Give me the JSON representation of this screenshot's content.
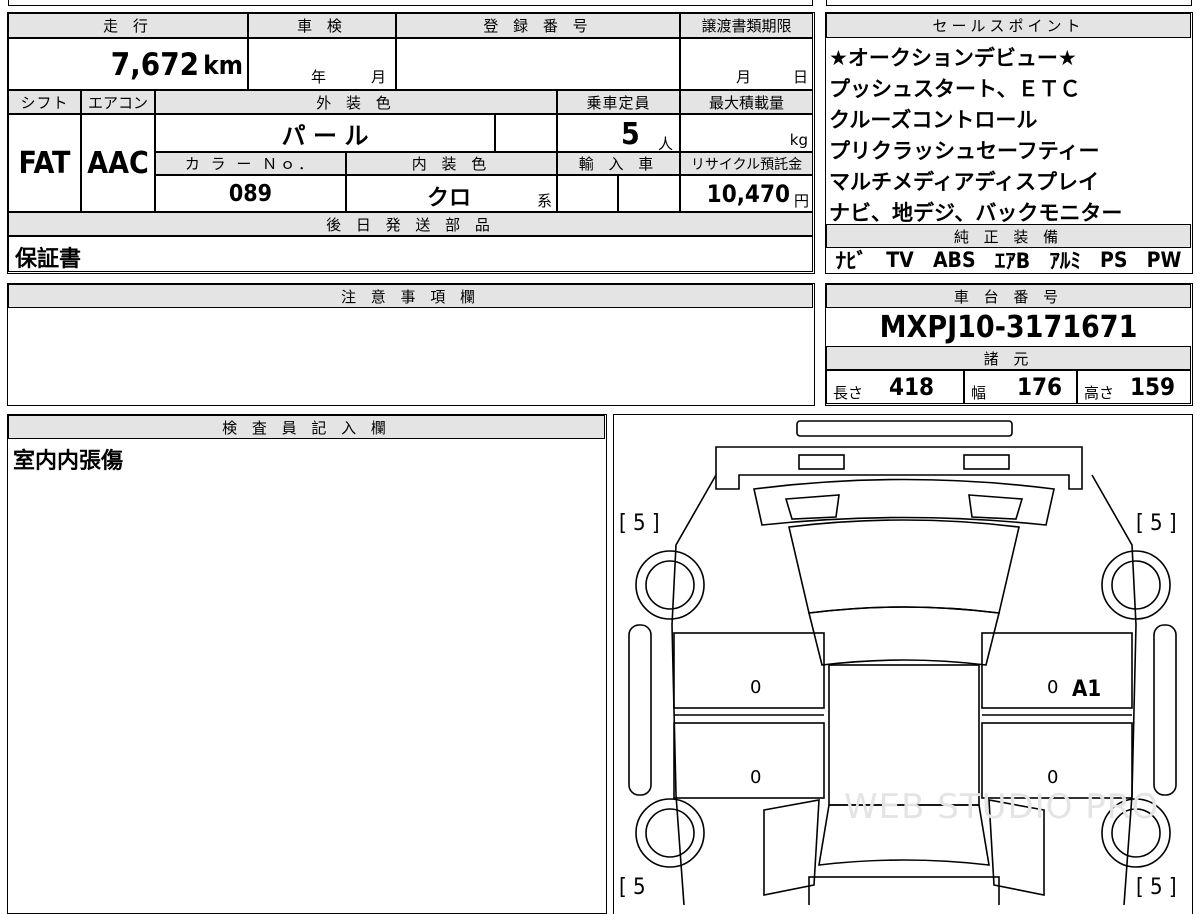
{
  "vehicle": {
    "mileage_label": "走 行",
    "mileage": "7,672",
    "mileage_unit": "km",
    "inspection_label": "車 検",
    "inspection_year": "年",
    "inspection_month": "月",
    "registration_label": "登 録 番 号",
    "transfer_label": "譲渡書類期限",
    "transfer_month": "月",
    "transfer_day": "日",
    "shift_label": "シフト",
    "shift": "FAT",
    "ac_label": "エアコン",
    "ac": "AAC",
    "exterior_label": "外 装 色",
    "exterior": "パ ー ル",
    "capacity_label": "乗車定員",
    "capacity": "5",
    "capacity_unit": "人",
    "maxload_label": "最大積載量",
    "maxload_unit": "kg",
    "color_no_label": "カ ラ ー Ｎｏ．",
    "color_no": "089",
    "interior_label": "内 装 色",
    "interior": "クロ",
    "interior_suffix": "系",
    "import_label": "輸 入 車",
    "recycle_label": "リサイクル預託金",
    "recycle": "10,470",
    "recycle_unit": "円",
    "later_parts_label": "後 日 発 送 部 品",
    "later_parts": "保証書",
    "caution_label": "注 意 事 項 欄",
    "inspector_label": "検 査 員 記 入 欄",
    "inspector_note": "室内内張傷"
  },
  "sales": {
    "label": "セールスポイント",
    "points": [
      "★オークションデビュー★",
      "プッシュスタート、ＥＴＣ",
      "クルーズコントロール",
      "プリクラッシュセーフティー",
      "マルチメディアディスプレイ",
      "ナビ、地デジ、バックモニター"
    ]
  },
  "equipment": {
    "label": "純 正 装 備",
    "items": [
      "ﾅﾋﾞ",
      "TV",
      "ABS",
      "ｴｱB",
      "ｱﾙﾐ",
      "PS",
      "PW"
    ]
  },
  "chassis": {
    "label": "車 台 番 号",
    "number": "MXPJ10-3171671"
  },
  "specs": {
    "label": "諸 元",
    "length_label": "長さ",
    "length": "418",
    "width_label": "幅",
    "width": "176",
    "height_label": "高さ",
    "height": "159"
  },
  "diagram": {
    "tire_fl": "[ 5 ]",
    "tire_fr": "[ 5 ]",
    "tire_rl": "[ 5",
    "tire_rr": "[ 5 ]",
    "door_fl": "0",
    "door_fr": "0",
    "door_fr_mark": "A1",
    "door_rl": "0",
    "door_rr": "0",
    "watermark": "WEB STUDIO PRO"
  }
}
